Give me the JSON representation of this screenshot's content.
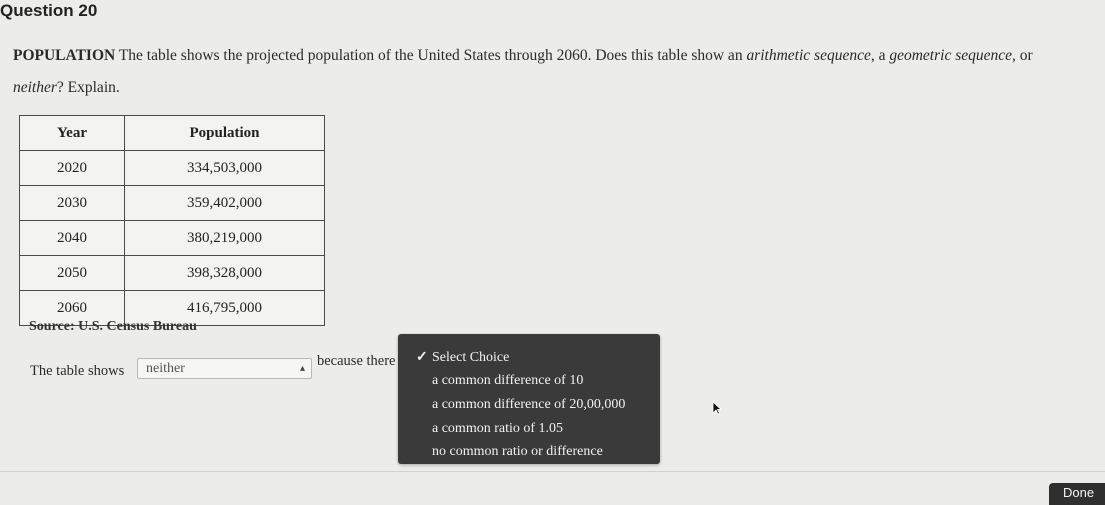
{
  "question": {
    "title": "Question 20",
    "keyword": "POPULATION",
    "text_1": "The table shows the projected population of the United States through 2060. Does this table show an",
    "italic_1": "arithmetic sequence",
    "text_2": ", a",
    "italic_2": "geometric sequence",
    "text_3": ", or",
    "italic_3": "neither",
    "text_4": "? Explain."
  },
  "table": {
    "headers": [
      "Year",
      "Population"
    ],
    "rows": [
      [
        "2020",
        "334,503,000"
      ],
      [
        "2030",
        "359,402,000"
      ],
      [
        "2040",
        "380,219,000"
      ],
      [
        "2050",
        "398,328,000"
      ],
      [
        "2060",
        "416,795,000"
      ]
    ],
    "source": "Source: U.S. Census Bureau"
  },
  "answer": {
    "prefix": "The table shows",
    "selected": "neither",
    "suffix": "because there"
  },
  "dropdown": {
    "options": [
      {
        "label": "Select Choice",
        "checked": true
      },
      {
        "label": "a common difference of 10",
        "checked": false
      },
      {
        "label": "a common difference of 20,00,000",
        "checked": false
      },
      {
        "label": "a common ratio of 1.05",
        "checked": false
      },
      {
        "label": "no common ratio or difference",
        "checked": false
      }
    ],
    "check_symbol": "✓"
  },
  "footer": {
    "done_label": "Done"
  },
  "colors": {
    "background": "#ececea",
    "dropdown_bg": "#3a3a3a",
    "done_bg": "#2f2f2f"
  }
}
